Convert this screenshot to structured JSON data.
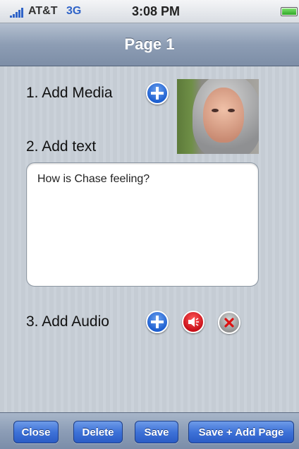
{
  "status_bar": {
    "carrier": "AT&T",
    "network": "3G",
    "time": "3:08 PM",
    "battery_level": 1.0
  },
  "nav_bar": {
    "title": "Page 1"
  },
  "form": {
    "media_label": "1. Add Media",
    "text_label": "2. Add text",
    "text_value": "How is Chase feeling?",
    "audio_label": "3. Add Audio"
  },
  "toolbar": {
    "close_label": "Close",
    "delete_label": "Delete",
    "save_label": "Save",
    "save_add_label": "Save + Add Page"
  },
  "icons": {
    "add_media": "plus-circle-icon",
    "add_audio": "plus-circle-icon",
    "play_audio": "speaker-icon",
    "delete_audio": "x-circle-icon"
  },
  "colors": {
    "nav_bar": "#8d9db4",
    "button_blue": "#3e72d8",
    "speaker_red": "#c80f18",
    "content_background": "#c5ccd4"
  }
}
